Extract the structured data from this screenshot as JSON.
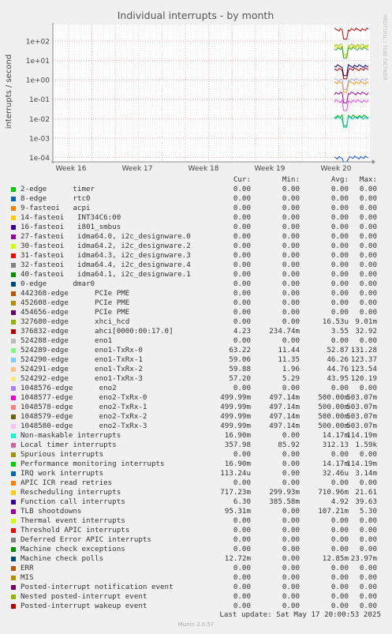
{
  "chart_data": {
    "type": "line",
    "title": "Individual interrupts - by month",
    "ylabel": "interrupts / second",
    "y_scale": "log",
    "ylim": [
      6e-05,
      700
    ],
    "y_ticks": [
      "1e+02",
      "1e+01",
      "1e+00",
      "1e-01",
      "1e-02",
      "1e-03",
      "1e-04"
    ],
    "x_ticks": [
      "Week 16",
      "Week 17",
      "Week 18",
      "Week 19",
      "Week 20"
    ],
    "side_label": "RRDTOOL / TOBI OETIKER",
    "grid": true,
    "series_summary": [
      {
        "color": "#cc0000",
        "level": 380
      },
      {
        "color": "#9acd32",
        "level": 60
      },
      {
        "color": "#dddd00",
        "level": 50
      },
      {
        "color": "#33aa33",
        "level": 40
      },
      {
        "color": "#000080",
        "level": 5
      },
      {
        "color": "#aa0000",
        "level": 3.5
      },
      {
        "color": "#ff9900",
        "level": 0.7
      },
      {
        "color": "#aaaaee",
        "level": 1.0
      },
      {
        "color": "#aa00aa",
        "level": 0.2
      },
      {
        "color": "#ee44ee",
        "level": 0.08
      },
      {
        "color": "#00bb00",
        "level": 0.013
      },
      {
        "color": "#00cccc",
        "level": 0.011
      },
      {
        "color": "#1155cc",
        "level": 0.0001
      }
    ]
  },
  "legend": {
    "headers": {
      "cur": "Cur:",
      "min": "Min:",
      "avg": "Avg:",
      "max": "Max:"
    },
    "rows": [
      {
        "label": "2-edge      timer",
        "color": "#00cc00",
        "cur": "0.00",
        "min": "0.00",
        "avg": "0.00",
        "max": "0.00"
      },
      {
        "label": "8-edge      rtc0",
        "color": "#0066b3",
        "cur": "0.00",
        "min": "0.00",
        "avg": "0.00",
        "max": "0.00"
      },
      {
        "label": "9-fasteoi   acpi",
        "color": "#ff8000",
        "cur": "0.00",
        "min": "0.00",
        "avg": "0.00",
        "max": "0.00"
      },
      {
        "label": "14-fasteoi   INT34C6:00",
        "color": "#ffcc00",
        "cur": "0.00",
        "min": "0.00",
        "avg": "0.00",
        "max": "0.00"
      },
      {
        "label": "16-fasteoi   i801_smbus",
        "color": "#330099",
        "cur": "0.00",
        "min": "0.00",
        "avg": "0.00",
        "max": "0.00"
      },
      {
        "label": "27-fasteoi   idma64.0, i2c_designware.0",
        "color": "#990099",
        "cur": "0.00",
        "min": "0.00",
        "avg": "0.00",
        "max": "0.00"
      },
      {
        "label": "30-fasteoi   idma64.2, i2c_designware.2",
        "color": "#ccff00",
        "cur": "0.00",
        "min": "0.00",
        "avg": "0.00",
        "max": "0.00"
      },
      {
        "label": "31-fasteoi   idma64.3, i2c_designware.3",
        "color": "#ff0000",
        "cur": "0.00",
        "min": "0.00",
        "avg": "0.00",
        "max": "0.00"
      },
      {
        "label": "32-fasteoi   idma64.4, i2c_designware.4",
        "color": "#808080",
        "cur": "0.00",
        "min": "0.00",
        "avg": "0.00",
        "max": "0.00"
      },
      {
        "label": "40-fasteoi   idma64.1, i2c_designware.1",
        "color": "#008f00",
        "cur": "0.00",
        "min": "0.00",
        "avg": "0.00",
        "max": "0.00"
      },
      {
        "label": "0-edge      dmar0",
        "color": "#00487d",
        "cur": "0.00",
        "min": "0.00",
        "avg": "0.00",
        "max": "0.00"
      },
      {
        "label": "442368-edge      PCIe PME",
        "color": "#b35a00",
        "cur": "0.00",
        "min": "0.00",
        "avg": "0.00",
        "max": "0.00"
      },
      {
        "label": "452608-edge      PCIe PME",
        "color": "#b38f00",
        "cur": "0.00",
        "min": "0.00",
        "avg": "0.00",
        "max": "0.00"
      },
      {
        "label": "454656-edge      PCIe PME",
        "color": "#6b006b",
        "cur": "0.00",
        "min": "0.00",
        "avg": "0.00",
        "max": "0.00"
      },
      {
        "label": "327680-edge      xhci_hcd",
        "color": "#8fb300",
        "cur": "0.00",
        "min": "0.00",
        "avg": "16.53u",
        "max": "9.01m"
      },
      {
        "label": "376832-edge      ahci[0000:00:17.0]",
        "color": "#b30000",
        "cur": "4.23",
        "min": "234.74m",
        "avg": "3.55",
        "max": "32.92"
      },
      {
        "label": "524288-edge      eno1",
        "color": "#bebebe",
        "cur": "0.00",
        "min": "0.00",
        "avg": "0.00",
        "max": "0.00"
      },
      {
        "label": "524289-edge      eno1-TxRx-0",
        "color": "#80ff80",
        "cur": "63.22",
        "min": "11.44",
        "avg": "52.87",
        "max": "131.28"
      },
      {
        "label": "524290-edge      eno1-TxRx-1",
        "color": "#80c9ff",
        "cur": "59.06",
        "min": "11.35",
        "avg": "46.26",
        "max": "123.37"
      },
      {
        "label": "524291-edge      eno1-TxRx-2",
        "color": "#ffc080",
        "cur": "59.88",
        "min": "1.96",
        "avg": "44.76",
        "max": "123.54"
      },
      {
        "label": "524292-edge      eno1-TxRx-3",
        "color": "#ffe680",
        "cur": "57.20",
        "min": "5.29",
        "avg": "43.95",
        "max": "120.19"
      },
      {
        "label": "1048576-edge      eno2",
        "color": "#aa80ff",
        "cur": "0.00",
        "min": "0.00",
        "avg": "0.00",
        "max": "0.00"
      },
      {
        "label": "1048577-edge      eno2-TxRx-0",
        "color": "#ee00cc",
        "cur": "499.99m",
        "min": "497.14m",
        "avg": "500.00m",
        "max": "503.07m"
      },
      {
        "label": "1048578-edge      eno2-TxRx-1",
        "color": "#ff8080",
        "cur": "499.99m",
        "min": "497.14m",
        "avg": "500.00m",
        "max": "503.07m"
      },
      {
        "label": "1048579-edge      eno2-TxRx-2",
        "color": "#666600",
        "cur": "499.99m",
        "min": "497.14m",
        "avg": "500.00m",
        "max": "503.07m"
      },
      {
        "label": "1048580-edge      eno2-TxRx-3",
        "color": "#ffbfff",
        "cur": "499.99m",
        "min": "497.14m",
        "avg": "500.00m",
        "max": "503.07m"
      },
      {
        "label": "Non-maskable interrupts",
        "color": "#00ffcc",
        "cur": "16.90m",
        "min": "0.00",
        "avg": "14.17m",
        "max": "114.19m"
      },
      {
        "label": "Local timer interrupts",
        "color": "#cc6699",
        "cur": "357.98",
        "min": "85.92",
        "avg": "312.13",
        "max": "1.59k"
      },
      {
        "label": "Spurious interrupts",
        "color": "#999900",
        "cur": "0.00",
        "min": "0.00",
        "avg": "0.00",
        "max": "0.00"
      },
      {
        "label": "Performance monitoring interrupts",
        "color": "#00cc00",
        "cur": "16.90m",
        "min": "0.00",
        "avg": "14.17m",
        "max": "114.19m"
      },
      {
        "label": "IRQ work interrupts",
        "color": "#0066b3",
        "cur": "113.24u",
        "min": "0.00",
        "avg": "32.46u",
        "max": "3.14m"
      },
      {
        "label": "APIC ICR read retries",
        "color": "#ff8000",
        "cur": "0.00",
        "min": "0.00",
        "avg": "0.00",
        "max": "0.00"
      },
      {
        "label": "Rescheduling interrupts",
        "color": "#ffcc00",
        "cur": "717.23m",
        "min": "299.93m",
        "avg": "710.96m",
        "max": "21.61"
      },
      {
        "label": "Function call interrupts",
        "color": "#330099",
        "cur": "6.30",
        "min": "385.58m",
        "avg": "4.92",
        "max": "39.63"
      },
      {
        "label": "TLB shootdowns",
        "color": "#990099",
        "cur": "95.31m",
        "min": "0.00",
        "avg": "107.21m",
        "max": "5.30"
      },
      {
        "label": "Thermal event interrupts",
        "color": "#ccff00",
        "cur": "0.00",
        "min": "0.00",
        "avg": "0.00",
        "max": "0.00"
      },
      {
        "label": "Threshold APIC interrupts",
        "color": "#ff0000",
        "cur": "0.00",
        "min": "0.00",
        "avg": "0.00",
        "max": "0.00"
      },
      {
        "label": "Deferred Error APIC interrupts",
        "color": "#808080",
        "cur": "0.00",
        "min": "0.00",
        "avg": "0.00",
        "max": "0.00"
      },
      {
        "label": "Machine check exceptions",
        "color": "#008f00",
        "cur": "0.00",
        "min": "0.00",
        "avg": "0.00",
        "max": "0.00"
      },
      {
        "label": "Machine check polls",
        "color": "#00487d",
        "cur": "12.72m",
        "min": "0.00",
        "avg": "12.85m",
        "max": "23.97m"
      },
      {
        "label": "ERR",
        "color": "#b35a00",
        "cur": "0.00",
        "min": "0.00",
        "avg": "0.00",
        "max": "0.00"
      },
      {
        "label": "MIS",
        "color": "#b38f00",
        "cur": "0.00",
        "min": "0.00",
        "avg": "0.00",
        "max": "0.00"
      },
      {
        "label": "Posted-interrupt notification event",
        "color": "#6b006b",
        "cur": "0.00",
        "min": "0.00",
        "avg": "0.00",
        "max": "0.00"
      },
      {
        "label": "Nested posted-interrupt event",
        "color": "#8fb300",
        "cur": "0.00",
        "min": "0.00",
        "avg": "0.00",
        "max": "0.00"
      },
      {
        "label": "Posted-interrupt wakeup event",
        "color": "#b30000",
        "cur": "0.00",
        "min": "0.00",
        "avg": "0.00",
        "max": "0.00"
      }
    ]
  },
  "last_update": "Last update: Sat May 17 20:00:53 2025",
  "footer": "Munin 2.0.57"
}
